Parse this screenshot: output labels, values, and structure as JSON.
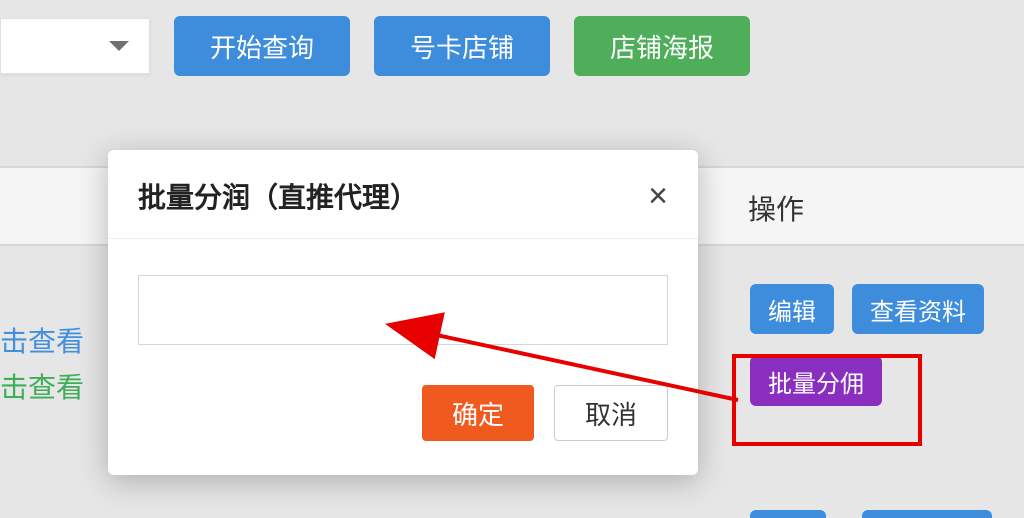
{
  "toolbar": {
    "start_query": "开始查询",
    "card_shop": "号卡店铺",
    "shop_poster": "店铺海报"
  },
  "table": {
    "col_op": "操作",
    "link_view_1": "击查看",
    "link_view_2": "击查看"
  },
  "row_actions": {
    "edit": "编辑",
    "view_profile": "查看资料",
    "batch_commission": "批量分佣"
  },
  "modal": {
    "title": "批量分润（直推代理）",
    "input_value": "",
    "confirm": "确定",
    "cancel": "取消"
  }
}
